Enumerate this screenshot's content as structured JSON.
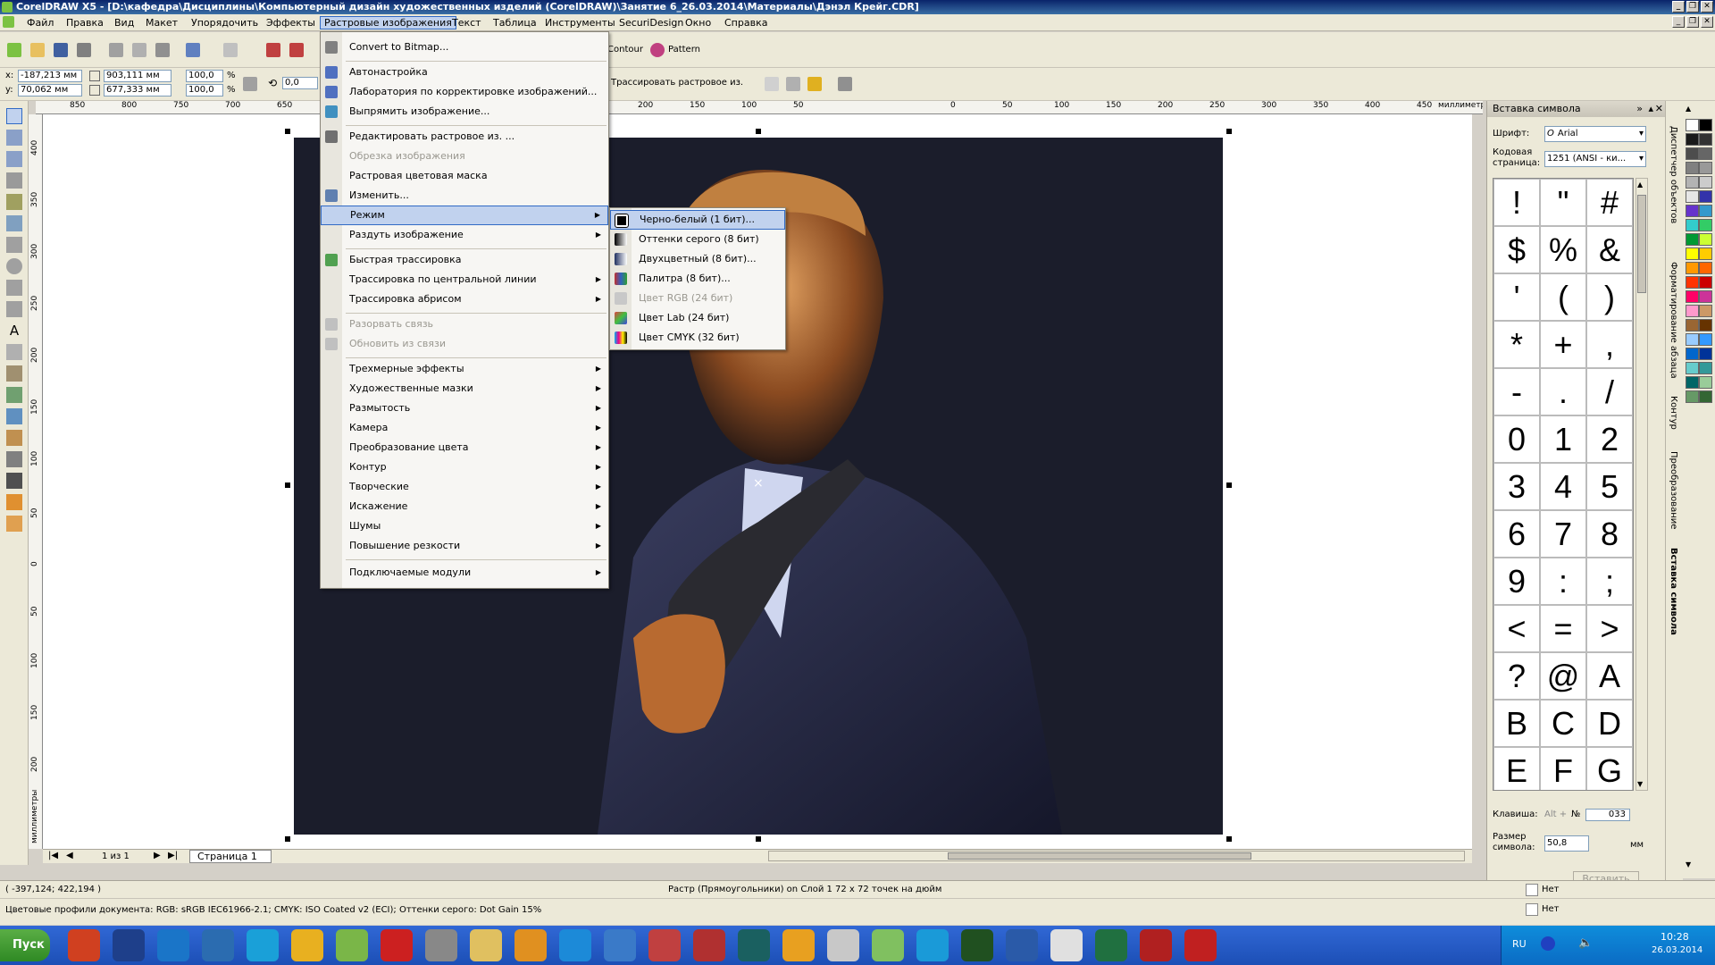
{
  "window": {
    "title": "CorelDRAW X5 - [D:\\кафедра\\Дисциплины\\Компьютерный дизайн художественных изделий (CorelDRAW)\\Занятие 6_26.03.2014\\Материалы\\Дэнэл Крейг.CDR]",
    "buttons": [
      "_",
      "❐",
      "✕"
    ]
  },
  "menubar": [
    "Файл",
    "Правка",
    "Вид",
    "Макет",
    "Упорядочить",
    "Эффекты",
    "Растровые изображения",
    "Текст",
    "Таблица",
    "Инструменты",
    "SecuriDesign",
    "Окно",
    "Справка"
  ],
  "toolbar": {
    "contour_label": "Contour",
    "pattern_label": "Pattern",
    "trace_label": "Трассировать растровое из.",
    "x_label": "x:",
    "y_label": "y:",
    "x_value": "-187,213 мм",
    "y_value": "70,062 мм",
    "width_value": "903,111 мм",
    "height_value": "677,333 мм",
    "scale_x": "100,0",
    "scale_y": "100,0",
    "percent": "%",
    "angle": "0,0"
  },
  "ruler": {
    "units": "миллиметры",
    "h_ticks": [
      "850",
      "800",
      "750",
      "700",
      "650",
      "250",
      "200",
      "150",
      "100",
      "50",
      "0",
      "50",
      "100",
      "150",
      "200",
      "250",
      "300",
      "350",
      "400",
      "450"
    ],
    "v_ticks": [
      "400",
      "350",
      "300",
      "250",
      "200",
      "150",
      "100",
      "50",
      "0",
      "50",
      "100",
      "150",
      "200",
      "250"
    ],
    "v_units": "миллиметры"
  },
  "bitmaps_menu": {
    "items": [
      {
        "label": "Convert to Bitmap...",
        "disabled": false,
        "submenu": false
      },
      {
        "label": "Автонастройка",
        "disabled": false,
        "submenu": false
      },
      {
        "label": "Лаборатория по корректировке изображений...",
        "disabled": false,
        "submenu": false
      },
      {
        "label": "Выпрямить изображение...",
        "disabled": false,
        "submenu": false
      },
      {
        "label": "Редактировать растровое из. ...",
        "disabled": false,
        "submenu": false
      },
      {
        "label": "Обрезка изображения",
        "disabled": true,
        "submenu": false
      },
      {
        "label": "Растровая цветовая маска",
        "disabled": false,
        "submenu": false
      },
      {
        "label": "Изменить...",
        "disabled": false,
        "submenu": false
      },
      {
        "label": "Режим",
        "disabled": false,
        "submenu": true
      },
      {
        "label": "Раздуть изображение",
        "disabled": false,
        "submenu": true
      },
      {
        "label": "Быстрая трассировка",
        "disabled": false,
        "submenu": false
      },
      {
        "label": "Трассировка по центральной линии",
        "disabled": false,
        "submenu": true
      },
      {
        "label": "Трассировка абрисом",
        "disabled": false,
        "submenu": true
      },
      {
        "label": "Разорвать связь",
        "disabled": true,
        "submenu": false
      },
      {
        "label": "Обновить из связи",
        "disabled": true,
        "submenu": false
      },
      {
        "label": "Трехмерные эффекты",
        "disabled": false,
        "submenu": true
      },
      {
        "label": "Художественные мазки",
        "disabled": false,
        "submenu": true
      },
      {
        "label": "Размытость",
        "disabled": false,
        "submenu": true
      },
      {
        "label": "Камера",
        "disabled": false,
        "submenu": true
      },
      {
        "label": "Преобразование цвета",
        "disabled": false,
        "submenu": true
      },
      {
        "label": "Контур",
        "disabled": false,
        "submenu": true
      },
      {
        "label": "Творческие",
        "disabled": false,
        "submenu": true
      },
      {
        "label": "Искажение",
        "disabled": false,
        "submenu": true
      },
      {
        "label": "Шумы",
        "disabled": false,
        "submenu": true
      },
      {
        "label": "Повышение резкости",
        "disabled": false,
        "submenu": true
      },
      {
        "label": "Подключаемые модули",
        "disabled": false,
        "submenu": true
      }
    ]
  },
  "mode_submenu": {
    "items": [
      {
        "label": "Черно-белый (1 бит)...",
        "disabled": false
      },
      {
        "label": "Оттенки серого (8 бит)",
        "disabled": false
      },
      {
        "label": "Двухцветный (8 бит)...",
        "disabled": false
      },
      {
        "label": "Палитра (8 бит)...",
        "disabled": false
      },
      {
        "label": "Цвет RGB (24 бит)",
        "disabled": true
      },
      {
        "label": "Цвет Lab (24 бит)",
        "disabled": false
      },
      {
        "label": "Цвет CMYK (32 бит)",
        "disabled": false
      }
    ]
  },
  "docker": {
    "title": "Вставка символа",
    "font_label": "Шрифт:",
    "font_value": "Arial",
    "codepage_label": "Кодовая страница:",
    "codepage_value": "1251  (ANSI - ки...",
    "glyphs": [
      "!",
      "\"",
      "#",
      "$",
      "%",
      "&",
      "'",
      "(",
      ")",
      "*",
      "+",
      ",",
      "-",
      ".",
      "/",
      "0",
      "1",
      "2",
      "3",
      "4",
      "5",
      "6",
      "7",
      "8",
      "9",
      ":",
      ";",
      "<",
      "=",
      ">",
      "?",
      "@",
      "A",
      "B",
      "C",
      "D",
      "E",
      "F",
      "G"
    ],
    "key_label": "Клавиша:",
    "key_hint": "Alt +",
    "num_label": "№",
    "num_value": "033",
    "size_label": "Размер символа:",
    "size_value": "50,8",
    "size_unit": "мм",
    "insert_label": "Вставить"
  },
  "docker_tabs": [
    "Диспетчер объектов",
    "Форматирование абзаца",
    "Контур",
    "Преобразование",
    "Вставка символа"
  ],
  "palette_colors": [
    "#ffffff",
    "#000000",
    "#1a1a1a",
    "#333333",
    "#4d4d4d",
    "#666666",
    "#808080",
    "#999999",
    "#b3b3b3",
    "#cccccc",
    "#e6e6e6",
    "#3333aa",
    "#6633cc",
    "#3399cc",
    "#33cccc",
    "#33cc66",
    "#009933",
    "#ccff33",
    "#ffff00",
    "#ffcc00",
    "#ff9900",
    "#ff6600",
    "#ff3300",
    "#cc0000",
    "#ff0066",
    "#cc3399",
    "#ff99cc",
    "#cc9966",
    "#996633",
    "#663300",
    "#99ccff",
    "#3399ff",
    "#0066cc",
    "#003399",
    "#66cccc",
    "#339999",
    "#006666",
    "#99cc99",
    "#669966",
    "#336633"
  ],
  "page": {
    "counter": "1 из 1",
    "tab": "Страница 1"
  },
  "status": {
    "coords": "( -397,124; 422,194 )",
    "object_info": "Растр (Прямоугольники) on Слой 1 72 x 72 точек на дюйм",
    "profiles": "Цветовые профили документа: RGB: sRGB IEC61966-2.1; CMYK: ISO Coated v2 (ECI); Оттенки серого: Dot Gain 15%",
    "fill_none": "Нет",
    "outline_none": "Нет"
  },
  "taskbar": {
    "start": "Пуск",
    "lang": "RU",
    "time": "10:28",
    "date": "26.03.2014",
    "app_colors": [
      "#d04020",
      "#1e3f8a",
      "#1a75c8",
      "#2b6cb0",
      "#1aa0d8",
      "#e8b020",
      "#7ab648",
      "#cc2020",
      "#888888",
      "#e0c060",
      "#e09020",
      "#1c8ad8",
      "#3a7ac8",
      "#c04040",
      "#b03030",
      "#1a6060",
      "#e8a020",
      "#c8c8c8",
      "#80c060",
      "#1a9ad8",
      "#205020",
      "#2a5aa8",
      "#e0e0e0",
      "#207040",
      "#b02020",
      "#c02020"
    ]
  },
  "colors": {
    "accent": "#316ac5",
    "menu_highlight": "#c1d2ee",
    "title_bar": "#0a246a"
  }
}
